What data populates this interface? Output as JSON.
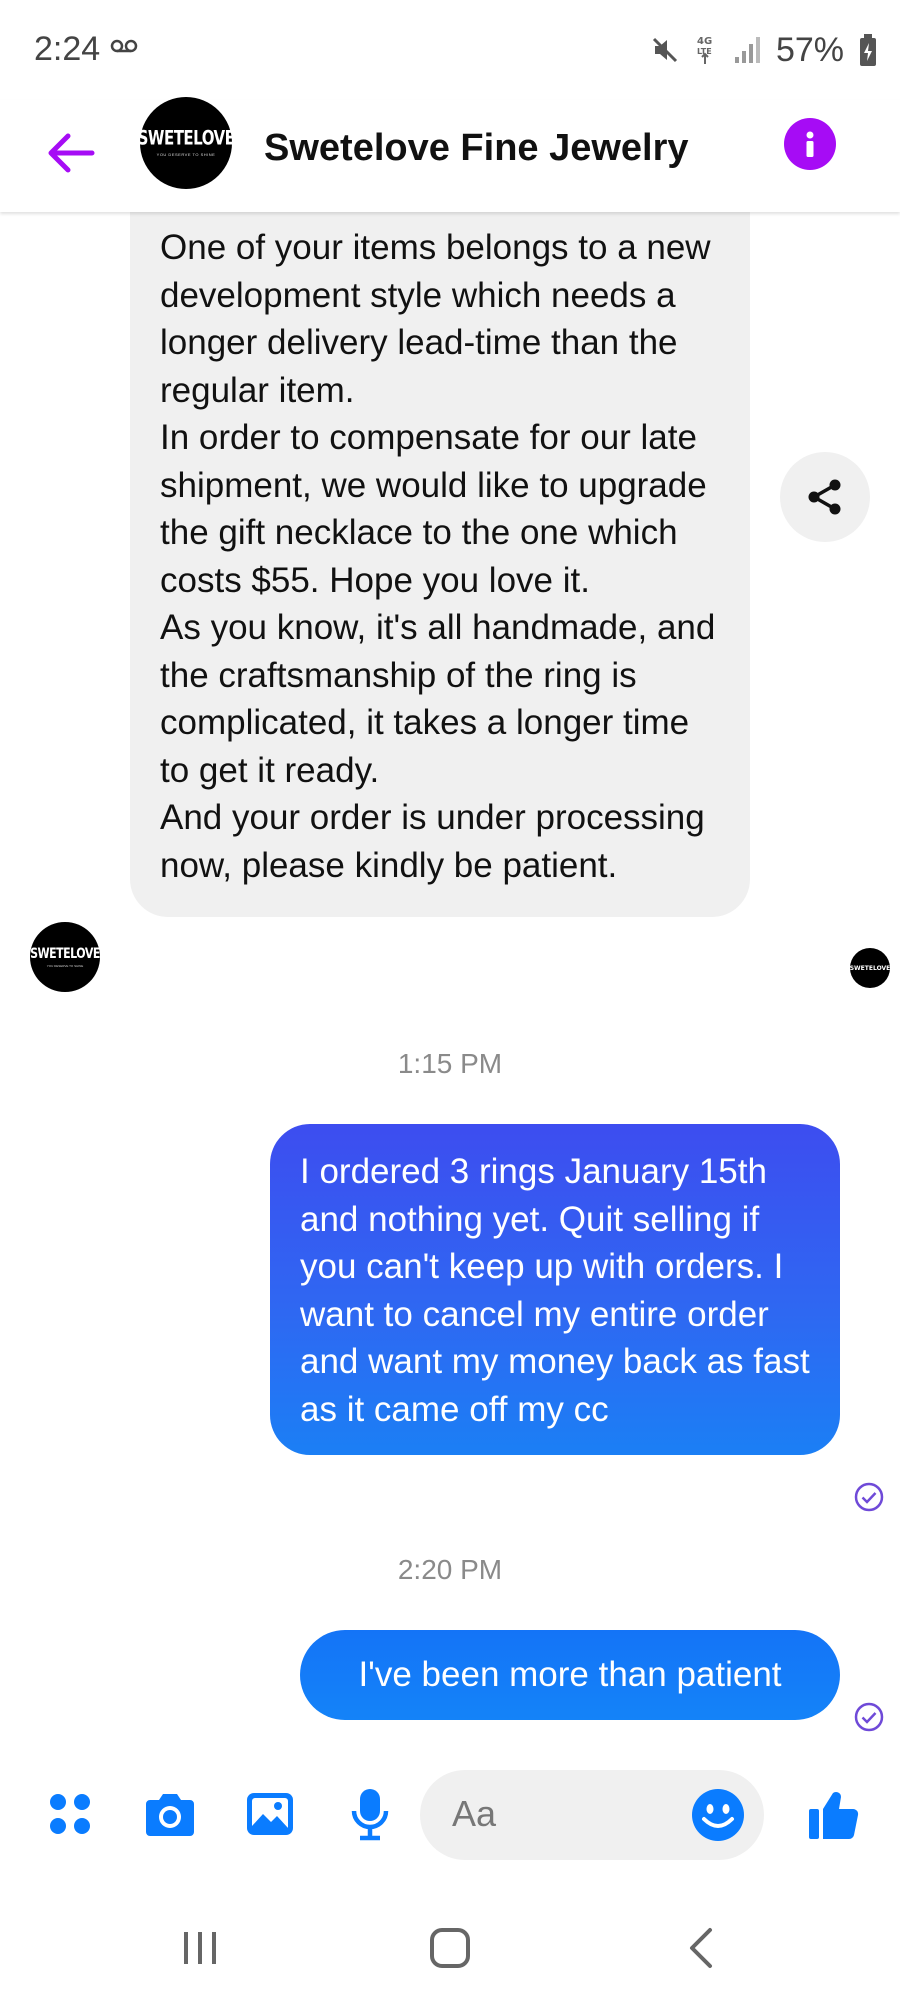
{
  "status_bar": {
    "time": "2:24",
    "network": "4G LTE",
    "battery": "57%"
  },
  "header": {
    "title": "Swetelove Fine Jewelry",
    "avatar_logo": "SWETELOVE",
    "avatar_tagline": "YOU DESERVE TO SHINE"
  },
  "conversation": {
    "incoming_message": {
      "lines": [
        "One of your items belongs to a new development style which needs a longer delivery lead-time than the regular item.",
        "In order to compensate for our late shipment, we would like to upgrade the gift necklace to the one which costs $55. Hope you love it.",
        "As you know, it's all handmade, and the craftsmanship of the ring is complicated, it takes a longer time to get it ready.",
        "And your order is under processing now, please kindly be patient."
      ]
    },
    "timestamp_1": "1:15 PM",
    "outgoing_message_1": "I ordered 3 rings January 15th and nothing yet. Quit selling if you can't keep up with orders. I want to cancel my entire order and want my money back as fast as it came off my cc",
    "timestamp_2": "2:20 PM",
    "outgoing_message_2": "I've been more than patient"
  },
  "composer": {
    "placeholder": "Aa",
    "icons": [
      "apps-icon",
      "camera-icon",
      "gallery-icon",
      "microphone-icon",
      "emoji-icon",
      "like-icon"
    ]
  },
  "colors": {
    "accent_purple": "#a60cf5",
    "outgoing_blue": "#1877f2",
    "messenger_blue": "#0a7cff"
  }
}
